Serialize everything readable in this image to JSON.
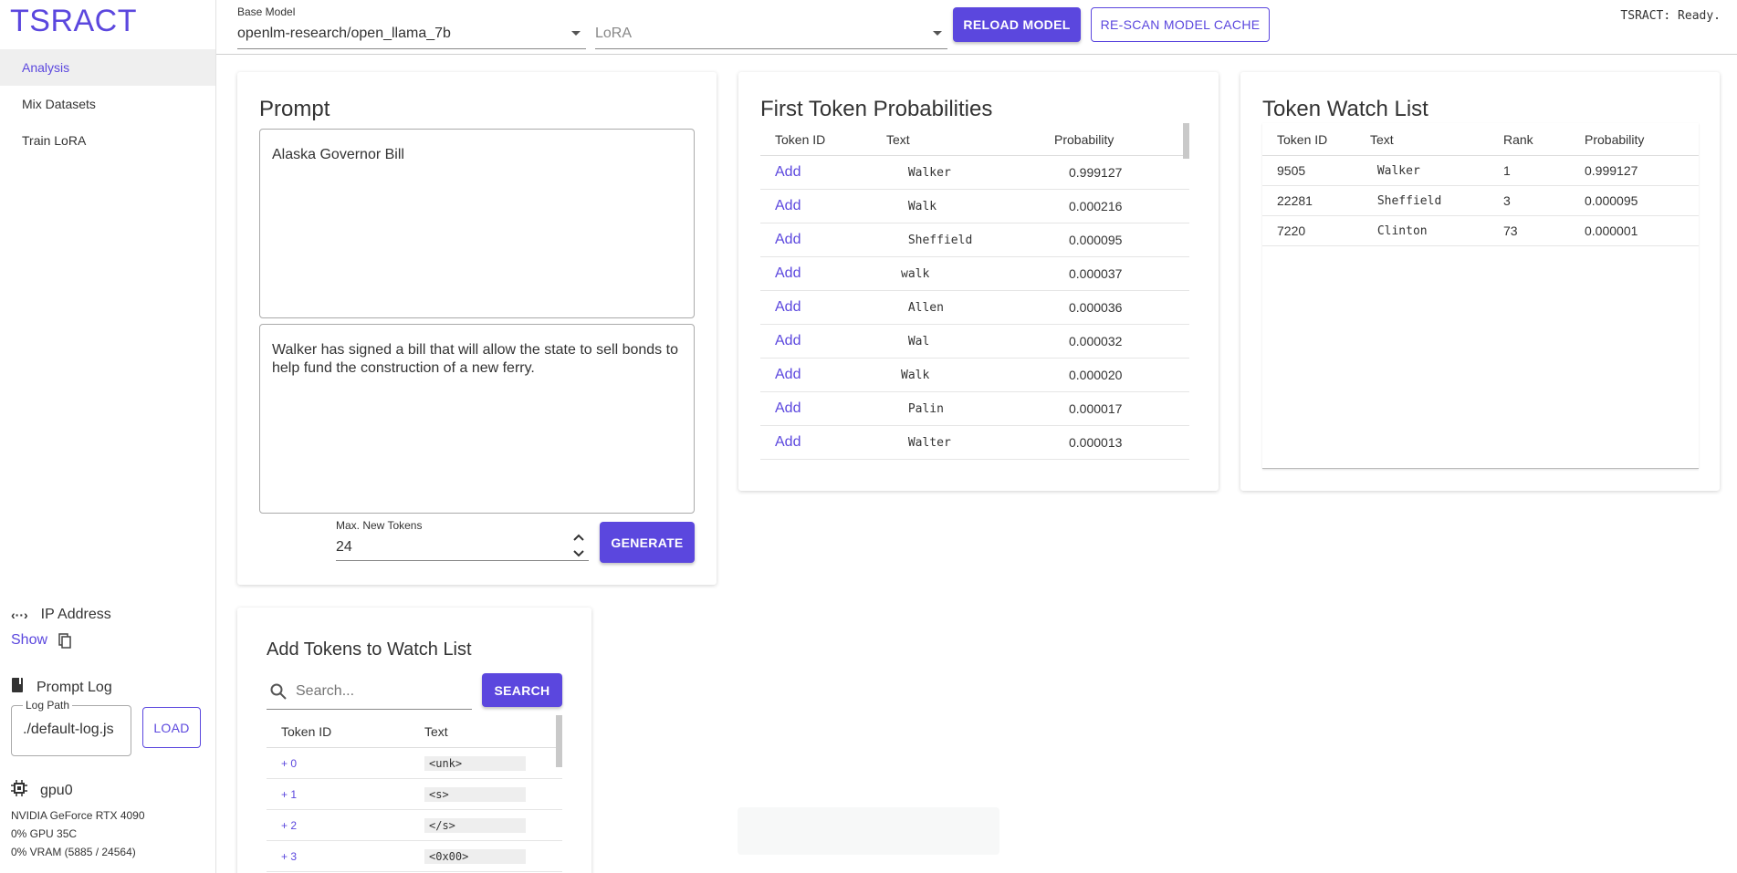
{
  "app": {
    "title": "TSRACT"
  },
  "nav": {
    "items": [
      {
        "label": "Analysis"
      },
      {
        "label": "Mix Datasets"
      },
      {
        "label": "Train LoRA"
      }
    ]
  },
  "ip": {
    "title": "IP Address",
    "show_label": "Show"
  },
  "prompt_log": {
    "title": "Prompt Log",
    "legend": "Log Path",
    "value": "./default-log.js",
    "load_label": "LOAD"
  },
  "gpu": {
    "title": "gpu0",
    "name": "NVIDIA GeForce RTX 4090",
    "usage": "0% GPU 35C",
    "vram": "0% VRAM (5885 / 24564)"
  },
  "topbar": {
    "base_model_label": "Base Model",
    "base_model_value": "openlm-research/open_llama_7b",
    "lora_placeholder": "LoRA",
    "reload_label": "RELOAD MODEL",
    "rescan_label": "RE-SCAN MODEL CACHE",
    "status": "TSRACT: Ready."
  },
  "prompt_card": {
    "title": "Prompt",
    "input_text": "Alaska Governor Bill",
    "output_text": " Walker has signed a bill that will allow the state to sell bonds to help fund the construction of a new ferry.",
    "max_tokens_label": "Max. New Tokens",
    "max_tokens_value": "24",
    "generate_label": "GENERATE"
  },
  "first_token": {
    "title": "First Token Probabilities",
    "headers": [
      "Token ID",
      "Text",
      "Probability"
    ],
    "rows": [
      {
        "action": "Add",
        "text": " Walker",
        "prob": "0.999127"
      },
      {
        "action": "Add",
        "text": " Walk",
        "prob": "0.000216"
      },
      {
        "action": "Add",
        "text": " Sheffield",
        "prob": "0.000095"
      },
      {
        "action": "Add",
        "text": "walk",
        "prob": "0.000037"
      },
      {
        "action": "Add",
        "text": " Allen",
        "prob": "0.000036"
      },
      {
        "action": "Add",
        "text": " Wal",
        "prob": "0.000032"
      },
      {
        "action": "Add",
        "text": "Walk",
        "prob": "0.000020"
      },
      {
        "action": "Add",
        "text": " Palin",
        "prob": "0.000017"
      },
      {
        "action": "Add",
        "text": " Walter",
        "prob": "0.000013"
      }
    ]
  },
  "watch_list": {
    "title": "Token Watch List",
    "headers": [
      "Token ID",
      "Text",
      "Rank",
      "Probability"
    ],
    "rows": [
      {
        "id": "9505",
        "text": " Walker",
        "rank": "1",
        "prob": "0.999127"
      },
      {
        "id": "22281",
        "text": " Sheffield",
        "rank": "3",
        "prob": "0.000095"
      },
      {
        "id": "7220",
        "text": " Clinton",
        "rank": "73",
        "prob": "0.000001"
      }
    ]
  },
  "add_tokens": {
    "title": "Add Tokens to Watch List",
    "search_placeholder": "Search...",
    "search_label": "SEARCH",
    "headers": [
      "Token ID",
      "Text"
    ],
    "rows": [
      {
        "id": "+ 0",
        "text": "<unk>"
      },
      {
        "id": "+ 1",
        "text": "<s>"
      },
      {
        "id": "+ 2",
        "text": "</s>"
      },
      {
        "id": "+ 3",
        "text": "<0x00>"
      }
    ]
  },
  "colors": {
    "accent": "#5b47de"
  }
}
